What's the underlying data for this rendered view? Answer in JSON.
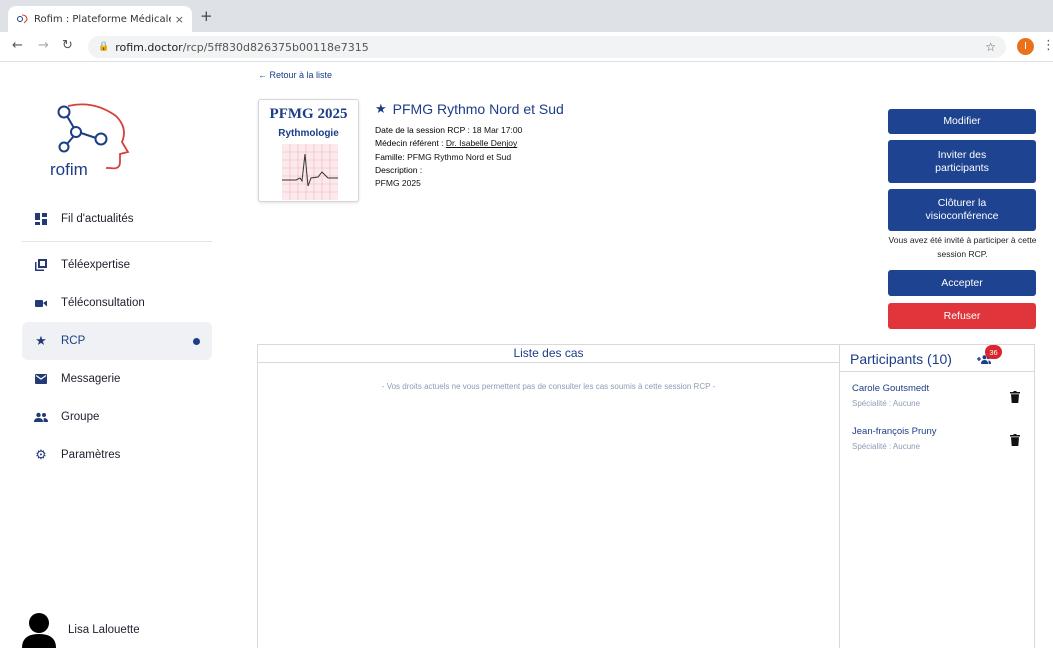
{
  "browser": {
    "tab_title": "Rofim : Plateforme Médicale, T",
    "tab_close": "×",
    "new_tab": "+",
    "url_host": "rofim.doctor",
    "url_path": "/rcp/5ff830d826375b00118e7315",
    "profile_initial": "I"
  },
  "sidebar": {
    "logo_text": "rofim",
    "items": [
      {
        "label": "Fil d'actualités",
        "icon": "dashboard-icon"
      },
      {
        "label": "Téléexpertise",
        "icon": "copy-icon"
      },
      {
        "label": "Téléconsultation",
        "icon": "video-camera-icon"
      },
      {
        "label": "RCP",
        "icon": "star-icon",
        "active": true
      },
      {
        "label": "Messagerie",
        "icon": "envelope-icon"
      },
      {
        "label": "Groupe",
        "icon": "group-icon"
      },
      {
        "label": "Paramètres",
        "icon": "gear-icon"
      }
    ],
    "user_name": "Lisa Lalouette"
  },
  "header": {
    "back_link": "← Retour à la liste",
    "thumb_title": "PFMG 2025",
    "thumb_subtitle": "Rythmologie",
    "session_title": "PFMG Rythmo Nord et Sud",
    "date_label": "Date de la session RCP :",
    "date_value": "18 Mar 17:00",
    "doctor_label": "Médecin référent :",
    "doctor_value": "Dr. Isabelle Denjoy",
    "family_label": "Famille:",
    "family_value": "PFMG Rythmo Nord et Sud",
    "description_label": "Description :",
    "description_value": "PFMG 2025"
  },
  "actions": {
    "modify": "Modifier",
    "invite": "Inviter des participants",
    "close_visio": "Clôturer la visioconférence",
    "invited_text": "Vous avez été invité à participer à cette session RCP.",
    "accept": "Accepter",
    "refuse": "Refuser"
  },
  "cases": {
    "title": "Liste des cas",
    "message": "- Vos droits actuels ne vous permettent pas de consulter les cas soumis à cette session RCP -"
  },
  "participants": {
    "title": "Participants (10)",
    "badge": "36",
    "list": [
      {
        "name": "Carole Goutsmedt",
        "speciality": "Spécialité : Aucune"
      },
      {
        "name": "Jean-françois Pruny",
        "speciality": "Spécialité : Aucune"
      }
    ]
  },
  "colors": {
    "primary": "#1e4390",
    "danger": "#e0353b",
    "badge": "#d8262c"
  }
}
